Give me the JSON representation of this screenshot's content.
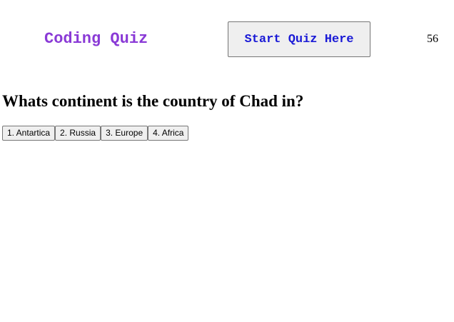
{
  "header": {
    "title": "Coding Quiz",
    "start_button_label": "Start Quiz Here",
    "timer": "56"
  },
  "quiz": {
    "question": "Whats continent is the country of Chad in?",
    "answers": [
      "1. Antartica",
      "2. Russia",
      "3. Europe",
      "4. Africa"
    ]
  },
  "colors": {
    "title": "#8a3ad6",
    "start_button_text": "#1a1ad6",
    "button_background": "#efefef"
  }
}
